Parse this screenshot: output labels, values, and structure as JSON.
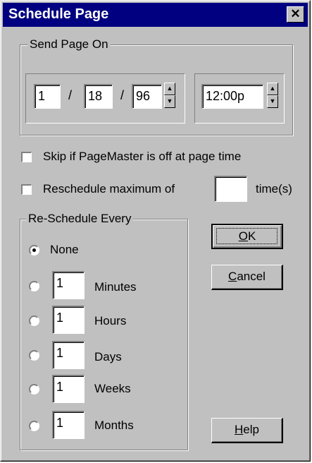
{
  "window": {
    "title": "Schedule Page",
    "close_glyph": "✕"
  },
  "send_page_on": {
    "legend": "Send Page On",
    "month": "1",
    "day": "18",
    "year": "96",
    "date_separator": "/",
    "time": "12:00p"
  },
  "options": {
    "skip_label": "Skip if PageMaster is off at page time",
    "skip_checked": false,
    "reschedule_label": "Reschedule maximum of",
    "reschedule_value": "",
    "reschedule_suffix": "time(s)",
    "reschedule_checked": false
  },
  "reschedule_every": {
    "legend": "Re-Schedule Every",
    "none_label": "None",
    "items": [
      {
        "value": "1",
        "label": "Minutes"
      },
      {
        "value": "1",
        "label": "Hours"
      },
      {
        "value": "1",
        "label": "Days"
      },
      {
        "value": "1",
        "label": "Weeks"
      },
      {
        "value": "1",
        "label": "Months"
      }
    ]
  },
  "buttons": {
    "ok": {
      "mnemonic": "O",
      "rest": "K"
    },
    "cancel": {
      "mnemonic": "C",
      "rest": "ancel"
    },
    "help": {
      "mnemonic": "H",
      "rest": "elp"
    }
  }
}
